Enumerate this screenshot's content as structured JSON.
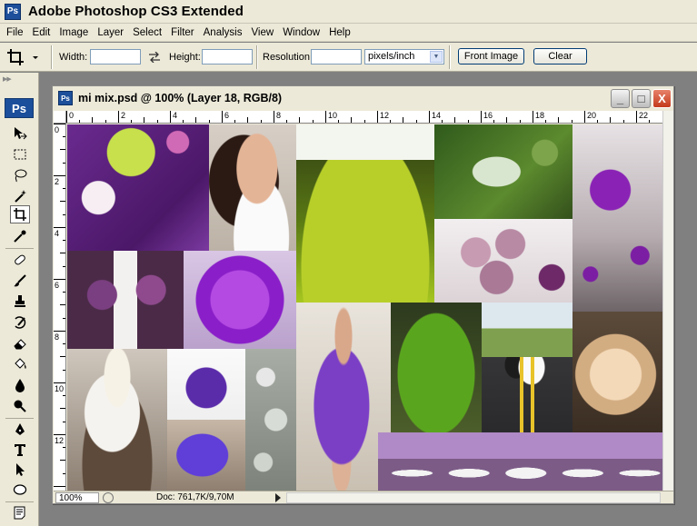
{
  "app": {
    "icon": "Ps",
    "title": "Adobe Photoshop CS3 Extended"
  },
  "menu": [
    "File",
    "Edit",
    "Image",
    "Layer",
    "Select",
    "Filter",
    "Analysis",
    "View",
    "Window",
    "Help"
  ],
  "options": {
    "tool_icon": "crop-icon",
    "width_label": "Width:",
    "width_value": "",
    "swap_icon": "swap-arrows-icon",
    "height_label": "Height:",
    "height_value": "",
    "resolution_label": "Resolution:",
    "resolution_value": "",
    "units": "pixels/inch",
    "front_image": "Front Image",
    "clear": "Clear"
  },
  "toolbox": {
    "badge": "Ps",
    "tools": [
      "move-icon",
      "marquee-icon",
      "lasso-icon",
      "magic-wand-icon",
      "crop-icon",
      "eyedropper-icon",
      "healing-brush-icon",
      "brush-icon",
      "clone-stamp-icon",
      "history-brush-icon",
      "eraser-icon",
      "paint-bucket-icon",
      "blur-icon",
      "dodge-icon",
      "pen-icon",
      "type-icon",
      "path-selection-icon",
      "ellipse-icon",
      "notes-icon"
    ],
    "active_tool": "crop-icon"
  },
  "document": {
    "icon": "Ps",
    "title": "mi mix.psd @ 100% (Layer 18, RGB/8)",
    "minimize": "_",
    "maximize": "□",
    "close": "X",
    "ruler_h_labels": [
      "0",
      "2",
      "4",
      "6",
      "8",
      "10",
      "12",
      "14",
      "16",
      "18",
      "20",
      "22"
    ],
    "ruler_v_labels": [
      "0",
      "2",
      "4",
      "6",
      "8",
      "10",
      "12"
    ],
    "zoom": "100%",
    "doc_info": "Doc: 761,7K/9,70M"
  },
  "colors": {
    "chrome": "#ece9d8",
    "workspace": "#808080",
    "purple": "#7b2ca8",
    "green": "#6ea32a"
  }
}
